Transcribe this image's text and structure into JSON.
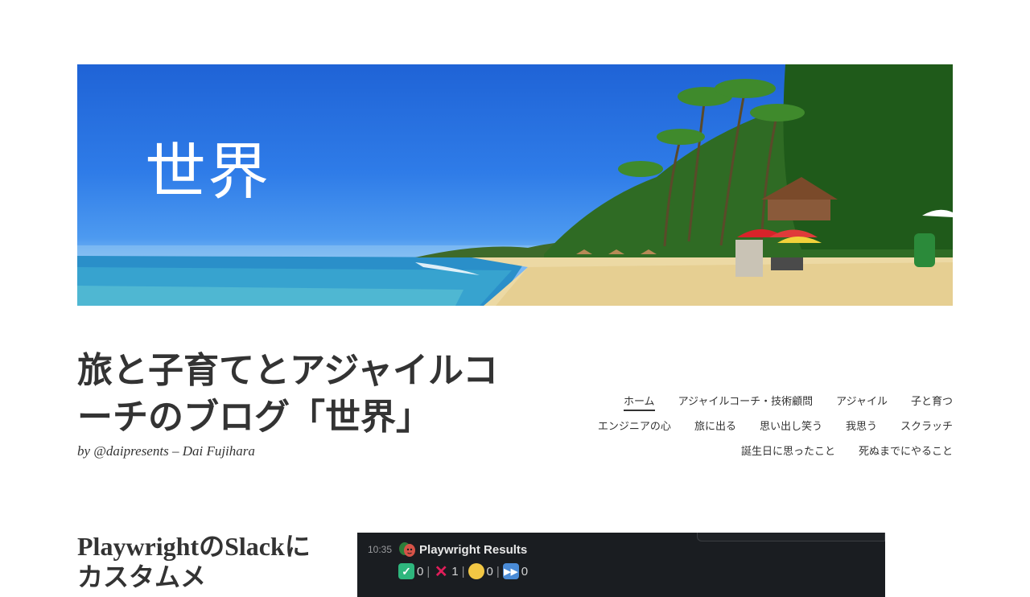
{
  "header": {
    "banner_title": "世界",
    "site_title": "旅と子育てとアジャイルコーチのブログ「世界」",
    "site_description": "by @daipresents – Dai Fujihara"
  },
  "nav": {
    "rows": [
      [
        {
          "label": "ホーム",
          "active": true
        },
        {
          "label": "アジャイルコーチ・技術顧問"
        },
        {
          "label": "アジャイル"
        },
        {
          "label": "子と育つ"
        }
      ],
      [
        {
          "label": "エンジニアの心"
        },
        {
          "label": "旅に出る"
        },
        {
          "label": "思い出し笑う"
        },
        {
          "label": "我思う"
        },
        {
          "label": "スクラッチ"
        }
      ],
      [
        {
          "label": "誕生日に思ったこと"
        },
        {
          "label": "死ぬまでにやること"
        }
      ]
    ]
  },
  "post": {
    "title": "PlaywrightのSlackにカスタムメ",
    "image": {
      "time": "10:35",
      "app_name": "Playwright Results",
      "stats": [
        {
          "icon": "check-icon",
          "color": "#2eb67d",
          "value": "0"
        },
        {
          "icon": "cross-icon",
          "color": "#e01e5a",
          "value": "1"
        },
        {
          "icon": "circle-icon",
          "color": "#f2c744",
          "value": "0"
        },
        {
          "icon": "fast-forward-icon",
          "color": "#4a8bd6",
          "value": "0"
        }
      ]
    }
  }
}
